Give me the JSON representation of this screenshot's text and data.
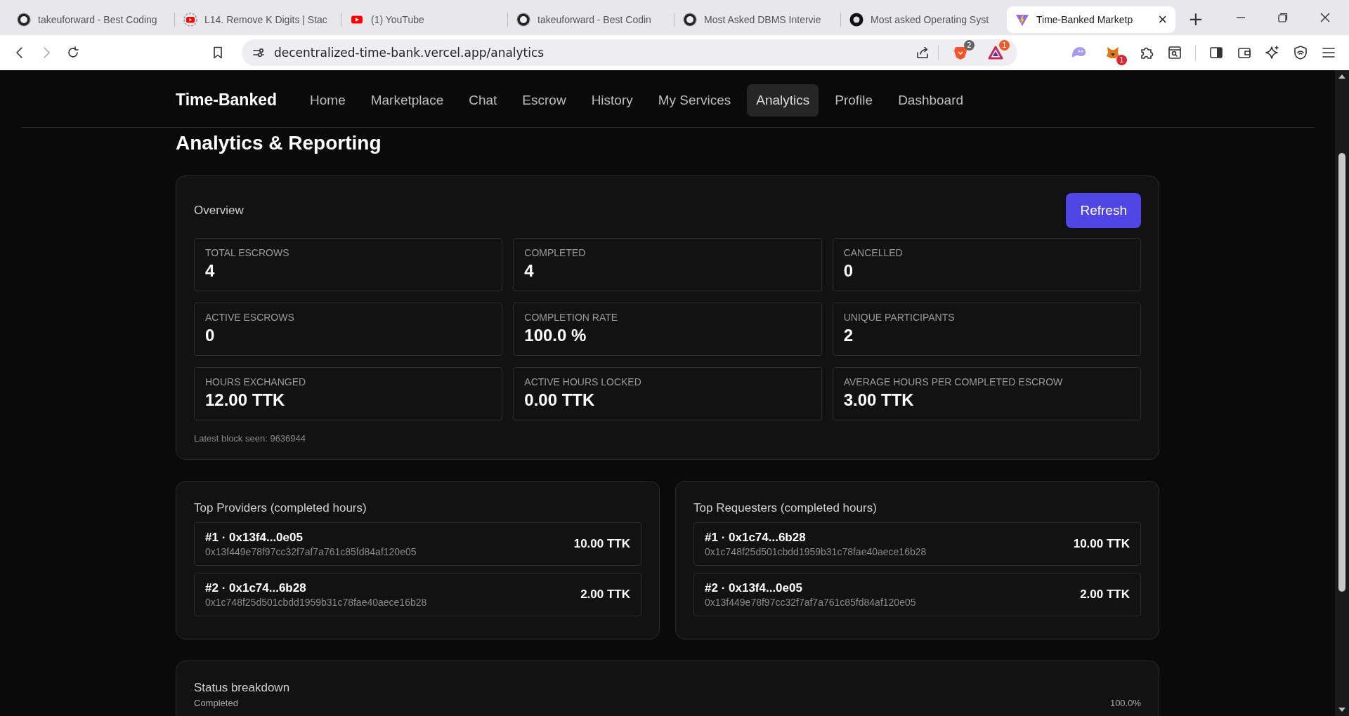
{
  "browser": {
    "tabs": [
      {
        "title": "takeuforward - Best Coding",
        "kind": "tuf",
        "selected": false
      },
      {
        "title": "L14. Remove K Digits | Stac",
        "kind": "youtube-loading",
        "selected": false
      },
      {
        "title": "(1) YouTube",
        "kind": "youtube",
        "selected": false
      },
      {
        "title": "takeuforward - Best Codin",
        "kind": "tuf",
        "selected": false
      },
      {
        "title": "Most Asked DBMS Intervie",
        "kind": "tuf",
        "selected": false
      },
      {
        "title": "Most asked Operating Syst",
        "kind": "tuf-dark",
        "selected": false
      },
      {
        "title": "Time-Banked Marketp",
        "kind": "vite",
        "selected": true
      }
    ],
    "new_tab": "+",
    "close_tab": "×",
    "url": "decentralized-time-bank.vercel.app/analytics",
    "badges": {
      "brave": "2",
      "rewards": "1",
      "wallet_ext": "1"
    }
  },
  "nav": {
    "brand": "Time-Banked",
    "items": [
      {
        "label": "Home",
        "selected": false
      },
      {
        "label": "Marketplace",
        "selected": false
      },
      {
        "label": "Chat",
        "selected": false
      },
      {
        "label": "Escrow",
        "selected": false
      },
      {
        "label": "History",
        "selected": false
      },
      {
        "label": "My Services",
        "selected": false
      },
      {
        "label": "Analytics",
        "selected": true
      },
      {
        "label": "Profile",
        "selected": false
      },
      {
        "label": "Dashboard",
        "selected": false
      }
    ]
  },
  "page_title": "Analytics & Reporting",
  "overview": {
    "title": "Overview",
    "refresh": "Refresh",
    "stats": [
      {
        "label": "TOTAL ESCROWS",
        "value": "4"
      },
      {
        "label": "COMPLETED",
        "value": "4"
      },
      {
        "label": "CANCELLED",
        "value": "0"
      },
      {
        "label": "ACTIVE ESCROWS",
        "value": "0"
      },
      {
        "label": "COMPLETION RATE",
        "value": "100.0 %"
      },
      {
        "label": "UNIQUE PARTICIPANTS",
        "value": "2"
      },
      {
        "label": "HOURS EXCHANGED",
        "value": "12.00 TTK"
      },
      {
        "label": "ACTIVE HOURS LOCKED",
        "value": "0.00 TTK"
      },
      {
        "label": "AVERAGE HOURS PER COMPLETED ESCROW",
        "value": "3.00 TTK"
      }
    ],
    "latest_block": "Latest block seen: 9636944"
  },
  "leaderboards": [
    {
      "title": "Top Providers (completed hours)",
      "rows": [
        {
          "name": "#1 · 0x13f4...0e05",
          "address": "0x13f449e78f97cc32f7af7a761c85fd84af120e05",
          "amount": "10.00 TTK"
        },
        {
          "name": "#2 · 0x1c74...6b28",
          "address": "0x1c748f25d501cbdd1959b31c78fae40aece16b28",
          "amount": "2.00 TTK"
        }
      ]
    },
    {
      "title": "Top Requesters (completed hours)",
      "rows": [
        {
          "name": "#1 · 0x1c74...6b28",
          "address": "0x1c748f25d501cbdd1959b31c78fae40aece16b28",
          "amount": "10.00 TTK"
        },
        {
          "name": "#2 · 0x13f4...0e05",
          "address": "0x13f449e78f97cc32f7af7a761c85fd84af120e05",
          "amount": "2.00 TTK"
        }
      ]
    }
  ],
  "status_breakdown": {
    "title": "Status breakdown",
    "rows": [
      {
        "label": "Completed",
        "value": "100.0%"
      }
    ]
  }
}
